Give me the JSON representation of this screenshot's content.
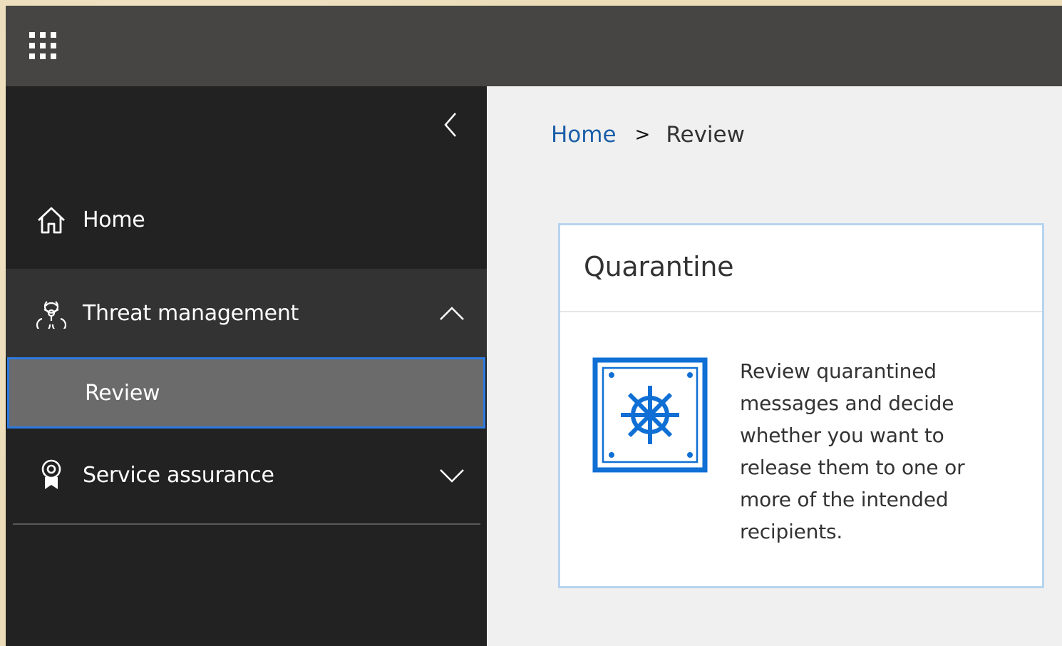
{
  "sidebar": {
    "items": [
      {
        "label": "Home",
        "icon": "home-icon"
      },
      {
        "label": "Threat management",
        "icon": "biohazard-icon",
        "expanded": true
      },
      {
        "label": "Review",
        "selected": true
      },
      {
        "label": "Service assurance",
        "icon": "ribbon-badge-icon",
        "expanded": false
      }
    ]
  },
  "breadcrumb": {
    "home": "Home",
    "separator": ">",
    "current": "Review"
  },
  "card": {
    "title": "Quarantine",
    "icon": "vault-safe-icon",
    "description": "Review quarantined messages and decide whether you want to release them to one or more of the intended recipients."
  },
  "colors": {
    "topbar": "#464544",
    "sidebar": "#222222",
    "selected": "#6b6b6b",
    "accent": "#2e7ae0",
    "icon_blue": "#0f6fd4"
  }
}
